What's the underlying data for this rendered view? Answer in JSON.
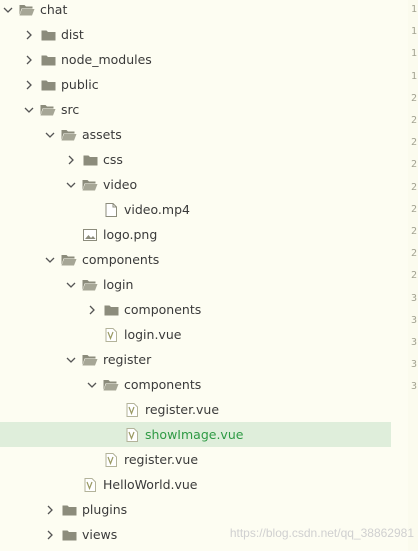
{
  "tree": [
    {
      "label": "chat",
      "depth": 0,
      "kind": "folder-open",
      "arrow": "down",
      "name": "tree-item-chat"
    },
    {
      "label": "dist",
      "depth": 1,
      "kind": "folder",
      "arrow": "right",
      "name": "tree-item-dist"
    },
    {
      "label": "node_modules",
      "depth": 1,
      "kind": "folder",
      "arrow": "right",
      "name": "tree-item-node-modules"
    },
    {
      "label": "public",
      "depth": 1,
      "kind": "folder",
      "arrow": "right",
      "name": "tree-item-public"
    },
    {
      "label": "src",
      "depth": 1,
      "kind": "folder-open",
      "arrow": "down",
      "name": "tree-item-src"
    },
    {
      "label": "assets",
      "depth": 2,
      "kind": "folder-open",
      "arrow": "down",
      "name": "tree-item-assets"
    },
    {
      "label": "css",
      "depth": 3,
      "kind": "folder",
      "arrow": "right",
      "name": "tree-item-css"
    },
    {
      "label": "video",
      "depth": 3,
      "kind": "folder-open",
      "arrow": "down",
      "name": "tree-item-video"
    },
    {
      "label": "video.mp4",
      "depth": 4,
      "kind": "file",
      "arrow": "none",
      "name": "tree-item-video-mp4"
    },
    {
      "label": "logo.png",
      "depth": 3,
      "kind": "image",
      "arrow": "none",
      "name": "tree-item-logo-png"
    },
    {
      "label": "components",
      "depth": 2,
      "kind": "folder-open",
      "arrow": "down",
      "name": "tree-item-components"
    },
    {
      "label": "login",
      "depth": 3,
      "kind": "folder-open",
      "arrow": "down",
      "name": "tree-item-login"
    },
    {
      "label": "components",
      "depth": 4,
      "kind": "folder",
      "arrow": "right",
      "name": "tree-item-login-components"
    },
    {
      "label": "login.vue",
      "depth": 4,
      "kind": "vue",
      "arrow": "none",
      "name": "tree-item-login-vue"
    },
    {
      "label": "register",
      "depth": 3,
      "kind": "folder-open",
      "arrow": "down",
      "name": "tree-item-register"
    },
    {
      "label": "components",
      "depth": 4,
      "kind": "folder-open",
      "arrow": "down",
      "name": "tree-item-register-components"
    },
    {
      "label": "register.vue",
      "depth": 5,
      "kind": "vue",
      "arrow": "none",
      "name": "tree-item-register-components-register-vue"
    },
    {
      "label": "showImage.vue",
      "depth": 5,
      "kind": "vue",
      "arrow": "none",
      "name": "tree-item-showimage-vue",
      "selected": true
    },
    {
      "label": "register.vue",
      "depth": 4,
      "kind": "vue",
      "arrow": "none",
      "name": "tree-item-register-vue"
    },
    {
      "label": "HelloWorld.vue",
      "depth": 3,
      "kind": "vue",
      "arrow": "none",
      "name": "tree-item-helloworld-vue"
    },
    {
      "label": "plugins",
      "depth": 2,
      "kind": "folder",
      "arrow": "right",
      "name": "tree-item-plugins"
    },
    {
      "label": "views",
      "depth": 2,
      "kind": "folder",
      "arrow": "right",
      "name": "tree-item-views"
    }
  ],
  "gutter_numbers": [
    "1",
    "1",
    "1",
    "1",
    "2",
    "2",
    "2",
    "2",
    "2",
    "2",
    "2",
    "2",
    "2",
    "3",
    "3",
    "3",
    "3",
    "3"
  ],
  "watermark": "https://blog.csdn.net/qq_38862981",
  "colors": {
    "background": "#fdfdf2",
    "selected_row": "#dfeedb",
    "selected_text": "#2e9a44",
    "folder": "#8c8c7c"
  }
}
